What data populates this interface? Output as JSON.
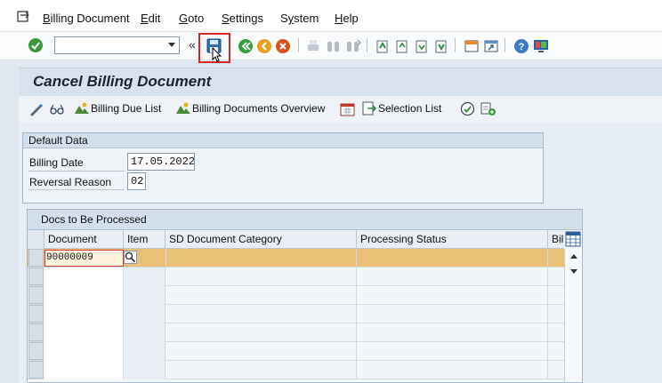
{
  "menu": {
    "items": [
      "Billing Document",
      "Edit",
      "Goto",
      "Settings",
      "System",
      "Help"
    ],
    "underline_chars": [
      "B",
      "E",
      "G",
      "S",
      "y",
      "H"
    ]
  },
  "toolbar": {
    "command_field": {
      "value": "",
      "placeholder": ""
    },
    "chevron": "«",
    "highlighted_button": "save"
  },
  "title": "Cancel Billing Document",
  "app_toolbar": {
    "billing_due_list": "Billing Due List",
    "billing_docs_overview": "Billing Documents Overview",
    "selection_list": "Selection List"
  },
  "default_data": {
    "title": "Default Data",
    "billing_date_label": "Billing Date",
    "billing_date_value": "17.05.2022",
    "reversal_reason_label": "Reversal Reason",
    "reversal_reason_value": "02"
  },
  "docs_table": {
    "title": "Docs to Be Processed",
    "columns": [
      "Document",
      "Item",
      "SD Document Category",
      "Processing Status",
      "Billi"
    ],
    "rows": [
      {
        "document": "90000009",
        "item": "",
        "category": "",
        "status": "",
        "billing": ""
      }
    ]
  },
  "colors": {
    "accent_highlight": "#d62727",
    "selected_row": "#e8c076",
    "title_bar": "#d7e2ec"
  }
}
